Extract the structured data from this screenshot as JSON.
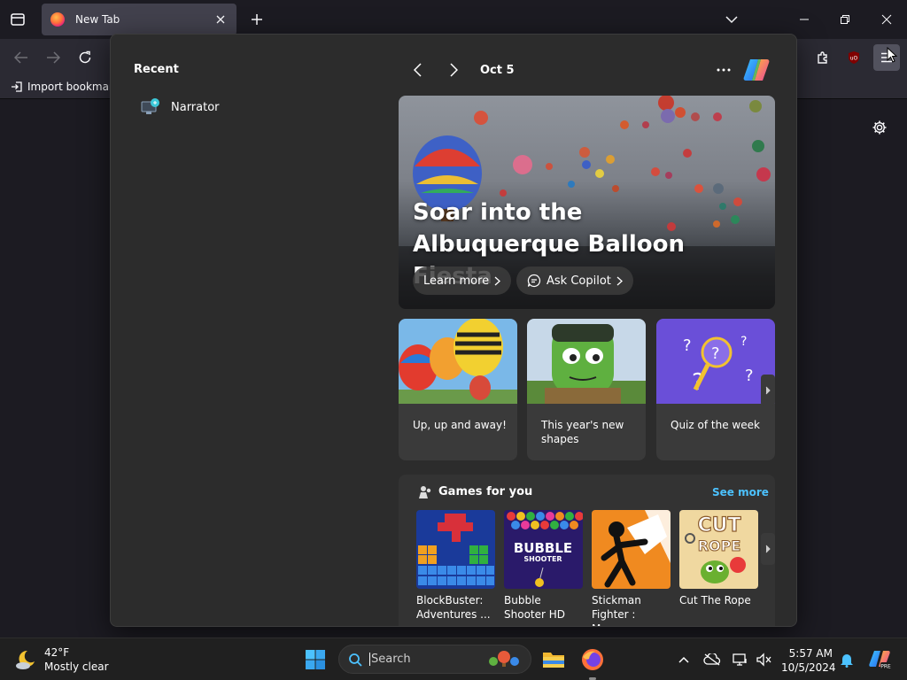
{
  "browser": {
    "tab_title": "New Tab",
    "bookmark_import_label": "Import bookmark"
  },
  "start_menu": {
    "recent_title": "Recent",
    "recent_items": [
      {
        "label": "Narrator",
        "icon": "narrator-icon"
      }
    ]
  },
  "widgets": {
    "date": "Oct 5",
    "hero": {
      "title": "Soar into the Albuquerque Balloon Fiesta",
      "learn_more_label": "Learn more",
      "ask_copilot_label": "Ask Copilot"
    },
    "cards": [
      {
        "label": "Up, up and away!"
      },
      {
        "label": "This year's new shapes"
      },
      {
        "label": "Quiz of the week"
      }
    ],
    "games": {
      "title": "Games for you",
      "see_more_label": "See more",
      "items": [
        {
          "label": "BlockBuster: Adventures ..."
        },
        {
          "label": "Bubble Shooter HD"
        },
        {
          "label": "Stickman Fighter : Mega..."
        },
        {
          "label": "Cut The Rope"
        }
      ]
    }
  },
  "taskbar": {
    "weather_temp": "42°F",
    "weather_desc": "Mostly clear",
    "search_placeholder": "Search",
    "time": "5:57 AM",
    "date": "10/5/2024"
  },
  "colors": {
    "accent_link": "#4cc2ff",
    "flyout_bg": "#2c2c2c",
    "taskbar_bg": "#202020"
  }
}
